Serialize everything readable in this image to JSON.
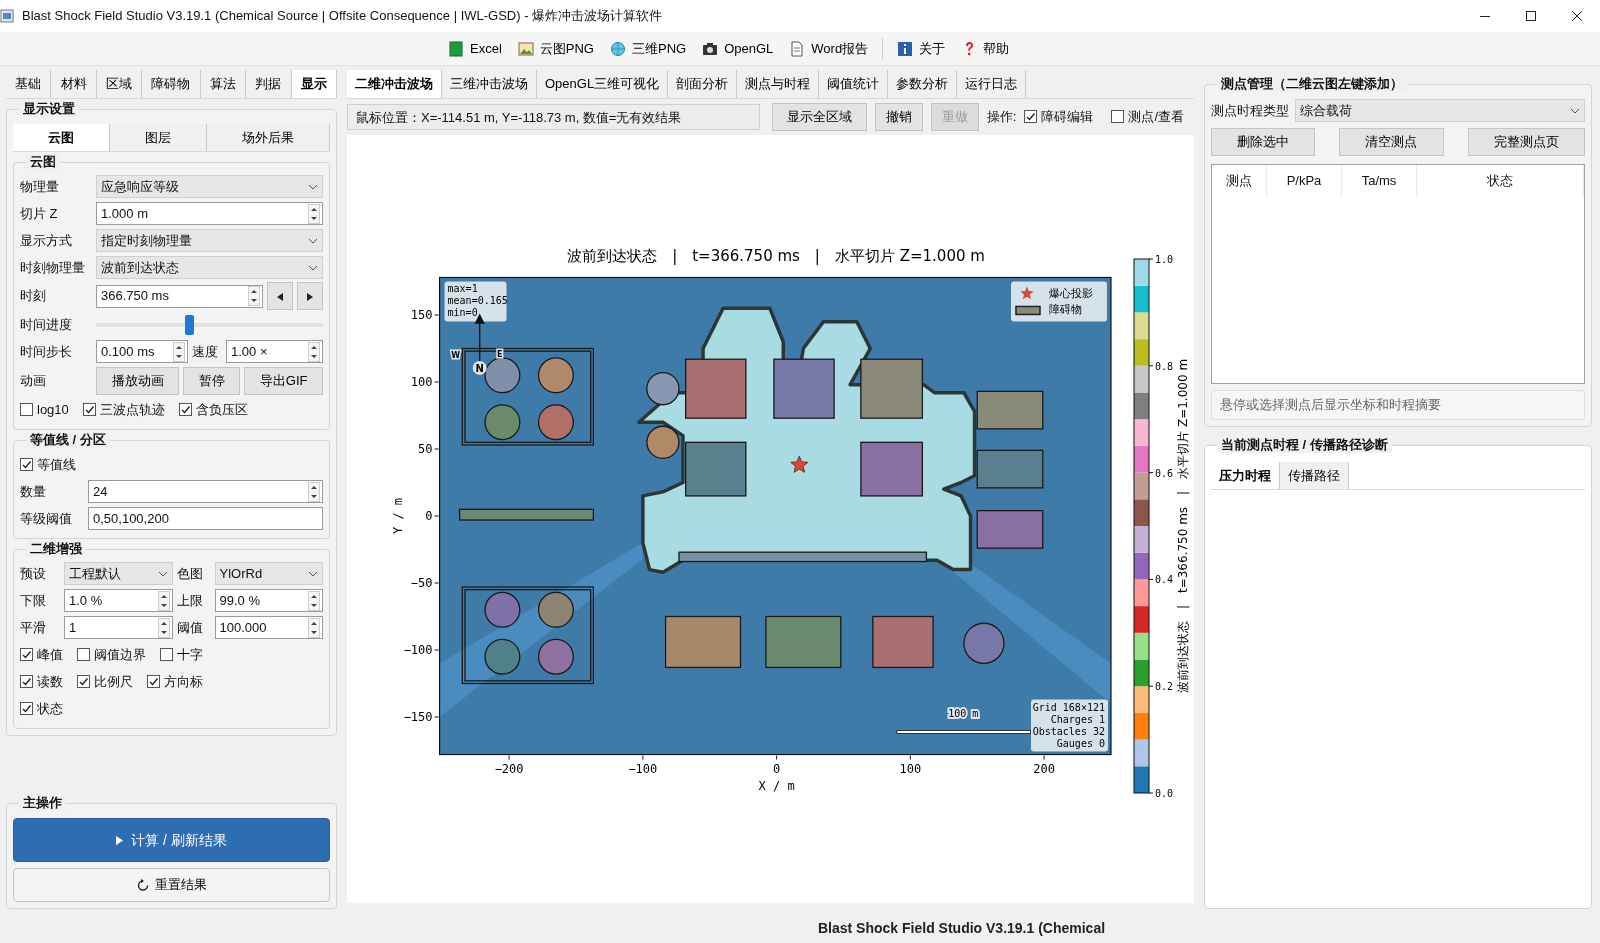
{
  "window": {
    "title": "Blast Shock Field Studio V3.19.1 (Chemical Source | Offsite Consequence | IWL-GSD) - 爆炸冲击波场计算软件"
  },
  "toolbar": [
    {
      "label": "Excel"
    },
    {
      "label": "云图PNG"
    },
    {
      "label": "三维PNG"
    },
    {
      "label": "OpenGL"
    },
    {
      "label": "Word报告"
    },
    {
      "label": "关于"
    },
    {
      "label": "帮助"
    }
  ],
  "left_tabs": [
    {
      "label": "基础",
      "selected": false
    },
    {
      "label": "材料",
      "selected": false
    },
    {
      "label": "区域",
      "selected": false
    },
    {
      "label": "障碍物",
      "selected": false
    },
    {
      "label": "算法",
      "selected": false
    },
    {
      "label": "判据",
      "selected": false
    },
    {
      "label": "显示",
      "selected": true
    }
  ],
  "display_settings": {
    "title": "显示设置",
    "subtabs": [
      {
        "label": "云图",
        "selected": true
      },
      {
        "label": "图层",
        "selected": false
      },
      {
        "label": "场外后果",
        "selected": false
      }
    ],
    "cloud": {
      "title": "云图",
      "quantity": {
        "label": "物理量",
        "value": "应急响应等级"
      },
      "slice_z": {
        "label": "切片 Z",
        "value": "1.000 m"
      },
      "display_mode": {
        "label": "显示方式",
        "value": "指定时刻物理量"
      },
      "time_quantity": {
        "label": "时刻物理量",
        "value": "波前到达状态"
      },
      "time": {
        "label": "时刻",
        "value": "366.750 ms"
      },
      "progress": {
        "label": "时间进度",
        "level": 0.41
      },
      "time_step": {
        "label": "时间步长",
        "value": "0.100 ms"
      },
      "speed": {
        "label": "速度",
        "value": "1.00 ×"
      },
      "animation": {
        "label": "动画",
        "buttons": [
          "播放动画",
          "暂停",
          "导出GIF"
        ]
      },
      "options": [
        {
          "label": "log10",
          "checked": false
        },
        {
          "label": "三波点轨迹",
          "checked": true
        },
        {
          "label": "含负压区",
          "checked": true
        }
      ]
    },
    "contours": {
      "title": "等值线 / 分区",
      "enabled": {
        "label": "等值线",
        "checked": true
      },
      "count": {
        "label": "数量",
        "value": "24"
      },
      "thresholds": {
        "label": "等级阈值",
        "value": "0,50,100,200"
      }
    },
    "enhance": {
      "title": "二维增强",
      "preset": {
        "label": "预设",
        "value": "工程默认"
      },
      "colormap": {
        "label": "色图",
        "value": "YlOrRd"
      },
      "lower": {
        "label": "下限",
        "value": "1.0 %"
      },
      "upper": {
        "label": "上限",
        "value": "99.0 %"
      },
      "smooth": {
        "label": "平滑",
        "value": "1"
      },
      "threshold": {
        "label": "阈值",
        "value": "100.000"
      },
      "option_rows": [
        [
          {
            "label": "峰值",
            "checked": true
          },
          {
            "label": "阈值边界",
            "checked": false
          },
          {
            "label": "十字",
            "checked": false
          }
        ],
        [
          {
            "label": "读数",
            "checked": true
          },
          {
            "label": "比例尺",
            "checked": true
          },
          {
            "label": "方向标",
            "checked": true
          }
        ],
        [
          {
            "label": "状态",
            "checked": true
          }
        ]
      ]
    }
  },
  "main_actions": {
    "title": "主操作",
    "primary": "计算 / 刷新结果",
    "reset": "重置结果"
  },
  "center_tabs": [
    {
      "label": "二维冲击波场",
      "selected": true
    },
    {
      "label": "三维冲击波场",
      "selected": false
    },
    {
      "label": "OpenGL三维可视化",
      "selected": false
    },
    {
      "label": "剖面分析",
      "selected": false
    },
    {
      "label": "测点与时程",
      "selected": false
    },
    {
      "label": "阈值统计",
      "selected": false
    },
    {
      "label": "参数分析",
      "selected": false
    },
    {
      "label": "运行日志",
      "selected": false
    }
  ],
  "plot_toolbar": {
    "readout": "鼠标位置：X=-114.51 m, Y=-118.73 m, 数值=无有效结果",
    "buttons": [
      {
        "label": "显示全区域",
        "disabled": false
      },
      {
        "label": "撤销",
        "disabled": false
      },
      {
        "label": "重做",
        "disabled": true
      }
    ],
    "operation_label": "操作:",
    "checks": [
      {
        "label": "障碍编辑",
        "checked": true
      },
      {
        "label": "测点/查看",
        "checked": false
      }
    ]
  },
  "plot": {
    "title": "波前到达状态　|　t=366.750 ms　|　水平切片 Z=1.000 m",
    "xlabel": "X / m",
    "ylabel": "Y / m",
    "xticks": [
      "−200",
      "−100",
      "0",
      "100",
      "200"
    ],
    "yticks": [
      "150",
      "100",
      "50",
      "0",
      "−50",
      "−100",
      "−150"
    ],
    "stats": [
      "max=1",
      "mean=0.165",
      "min=0"
    ],
    "legend": [
      "爆心投影",
      "障碍物"
    ],
    "info": [
      "Grid 168×121",
      "Charges 1",
      "Obstacles 32",
      "Gauges 0"
    ],
    "scale": "100 m",
    "compass": [
      "W",
      "N",
      "E"
    ],
    "colorbar_ticks": [
      "1.0",
      "0.8",
      "0.6",
      "0.4",
      "0.2",
      "0.0"
    ],
    "colorbar_label": "波前到达状态　|　t=366.750 ms　|　水平切片 Z=1.000 m"
  },
  "gauges": {
    "title": "测点管理（二维云图左键添加）",
    "type_label": "测点时程类型",
    "type_value": "综合载荷",
    "buttons": [
      "删除选中",
      "清空测点",
      "完整测点页"
    ],
    "columns": [
      "测点",
      "P/kPa",
      "Ta/ms",
      "状态"
    ],
    "hint": "悬停或选择测点后显示坐标和时程摘要"
  },
  "history": {
    "title": "当前测点时程 / 传播路径诊断",
    "tabs": [
      {
        "label": "压力时程",
        "selected": true
      },
      {
        "label": "传播路径",
        "selected": false
      }
    ]
  },
  "status_bar": "Blast Shock Field Studio V3.19.1 (Chemical"
}
